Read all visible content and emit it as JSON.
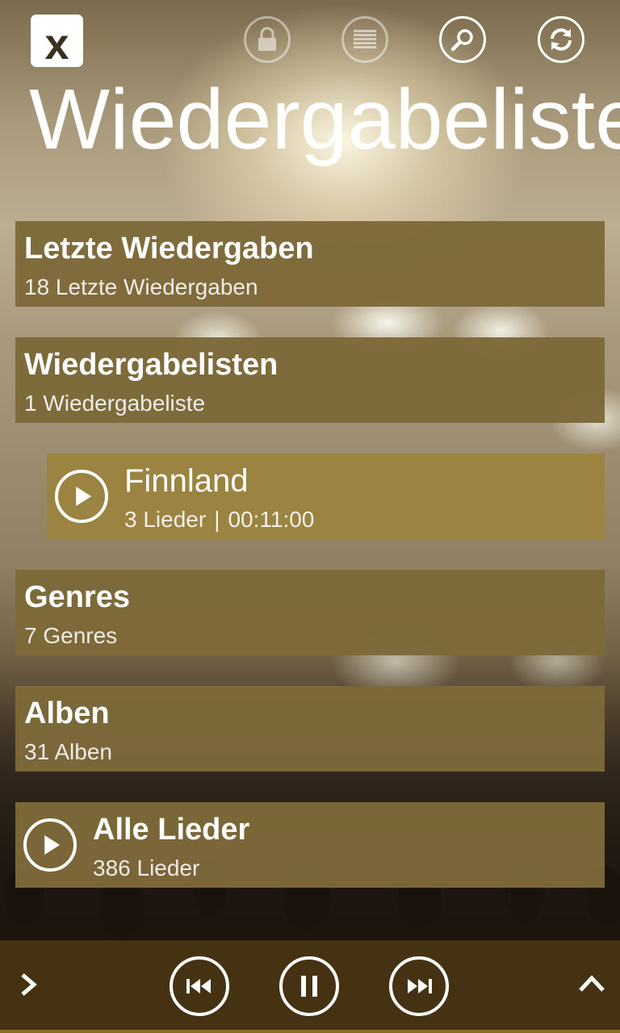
{
  "app": {
    "logo_text": "x",
    "page_title": "Wiedergabelisten"
  },
  "topbar": {
    "icons": [
      "lock-icon",
      "list-icon",
      "search-icon",
      "refresh-icon"
    ]
  },
  "tiles": [
    {
      "title": "Letzte Wiedergaben",
      "subtitle": "18 Letzte Wiedergaben"
    },
    {
      "title": "Wiedergabelisten",
      "subtitle": "1 Wiedergabeliste"
    },
    {
      "title": "Finnland",
      "songs": "3 Lieder",
      "separator": "|",
      "duration": "00:11:00"
    },
    {
      "title": "Genres",
      "subtitle": "7 Genres"
    },
    {
      "title": "Alben",
      "subtitle": "31 Alben"
    },
    {
      "title": "Alle Lieder",
      "subtitle": "386 Lieder"
    }
  ],
  "player": {
    "controls": [
      "previous-icon",
      "pause-icon",
      "next-icon"
    ]
  },
  "colors": {
    "tile": "#7d693a",
    "tile_highlight": "#9b8340",
    "player_bar": "#483414",
    "accent_line": "#8a6a28"
  }
}
